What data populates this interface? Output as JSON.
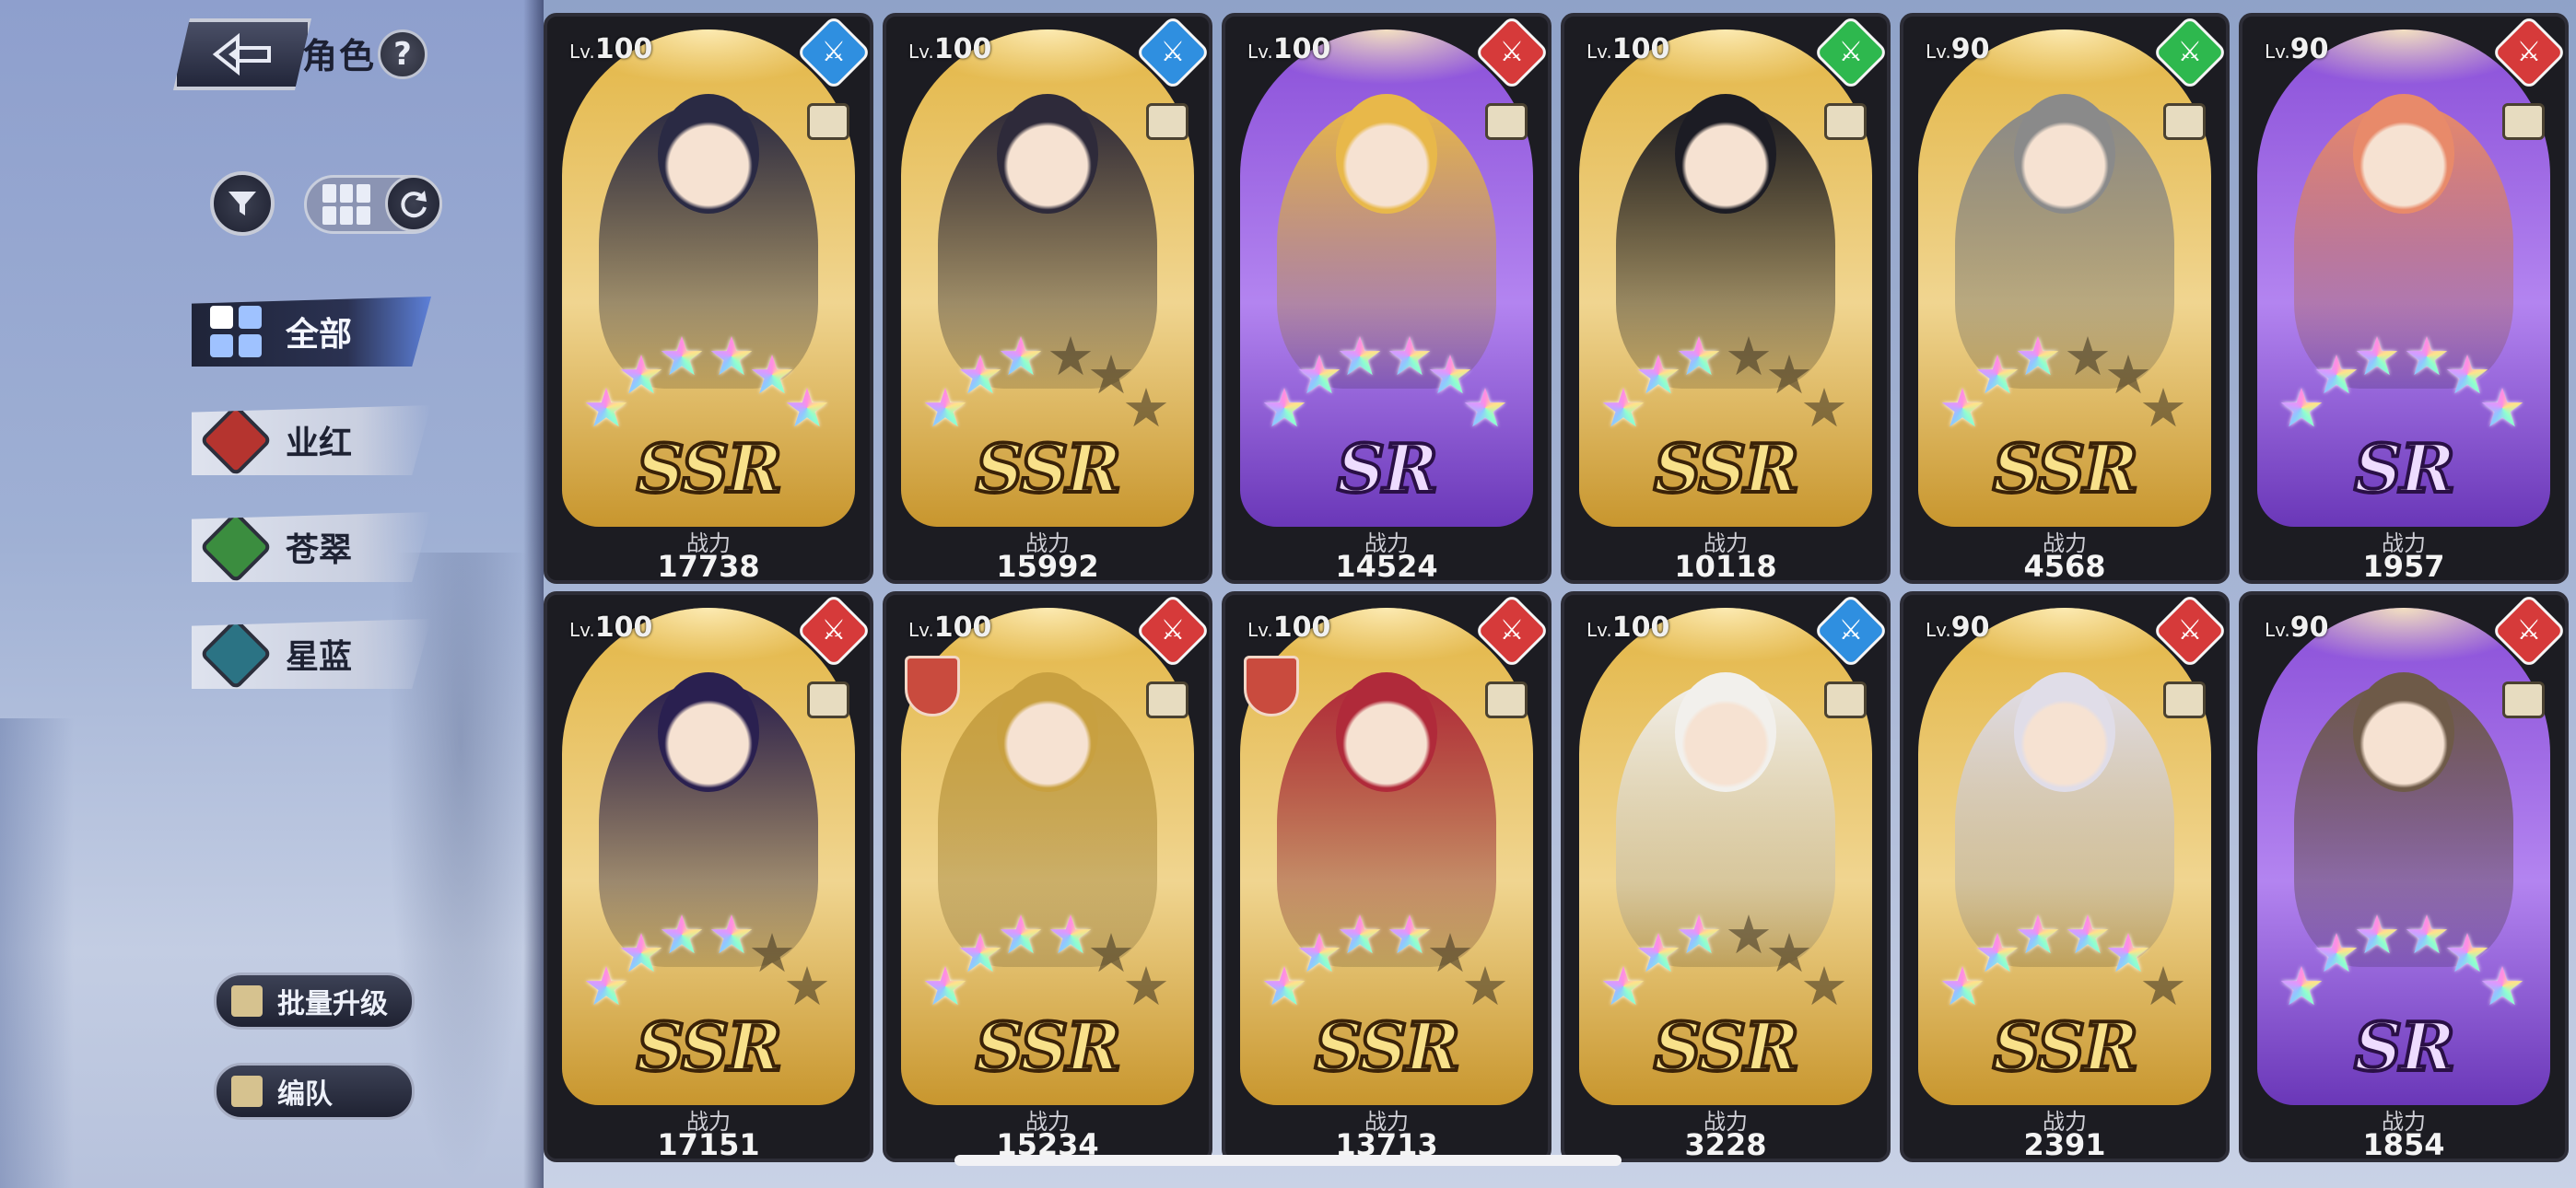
{
  "header": {
    "title": "角色",
    "help": "?"
  },
  "filters": [
    {
      "label": "全部",
      "icon": "all-grid-icon",
      "active": true
    },
    {
      "label": "业红",
      "icon": "red-gem-icon",
      "color": "#b5342f"
    },
    {
      "label": "苍翠",
      "icon": "green-gem-icon",
      "color": "#3b8d3f"
    },
    {
      "label": "星蓝",
      "icon": "blue-gem-icon",
      "color": "#2b7384"
    }
  ],
  "actions": {
    "batch_upgrade": "批量升级",
    "formation": "编队"
  },
  "power_label": "战力",
  "cards": [
    {
      "level": "100",
      "rarity": "SSR",
      "element": "blue",
      "power": "17738",
      "stars": 6,
      "portrait_hue": "#2a2a44"
    },
    {
      "level": "100",
      "rarity": "SSR",
      "element": "blue",
      "power": "15992",
      "stars": 3,
      "portrait_hue": "#2e2a3a"
    },
    {
      "level": "100",
      "rarity": "SR",
      "element": "red",
      "power": "14524",
      "stars": 6,
      "portrait_hue": "#e8b84a"
    },
    {
      "level": "100",
      "rarity": "SSR",
      "element": "green",
      "power": "10118",
      "stars": 3,
      "portrait_hue": "#1c1c24"
    },
    {
      "level": "90",
      "rarity": "SSR",
      "element": "green",
      "power": "4568",
      "stars": 3,
      "portrait_hue": "#8a8a8a"
    },
    {
      "level": "90",
      "rarity": "SR",
      "element": "red",
      "power": "1957",
      "stars": 6,
      "portrait_hue": "#e88a6a"
    },
    {
      "level": "100",
      "rarity": "SSR",
      "element": "red",
      "power": "17151",
      "stars": 4,
      "portrait_hue": "#2a2050"
    },
    {
      "level": "100",
      "rarity": "SSR",
      "element": "red",
      "power": "15234",
      "stars": 4,
      "portrait_hue": "#c8a040"
    },
    {
      "level": "100",
      "rarity": "SSR",
      "element": "red",
      "power": "13713",
      "stars": 4,
      "portrait_hue": "#b02a3a"
    },
    {
      "level": "100",
      "rarity": "SSR",
      "element": "blue",
      "power": "3228",
      "stars": 3,
      "portrait_hue": "#f2f0ec"
    },
    {
      "level": "90",
      "rarity": "SSR",
      "element": "red",
      "power": "2391",
      "stars": 5,
      "portrait_hue": "#e0dde8"
    },
    {
      "level": "90",
      "rarity": "SR",
      "element": "red",
      "power": "1854",
      "stars": 6,
      "portrait_hue": "#6e5a48"
    }
  ]
}
